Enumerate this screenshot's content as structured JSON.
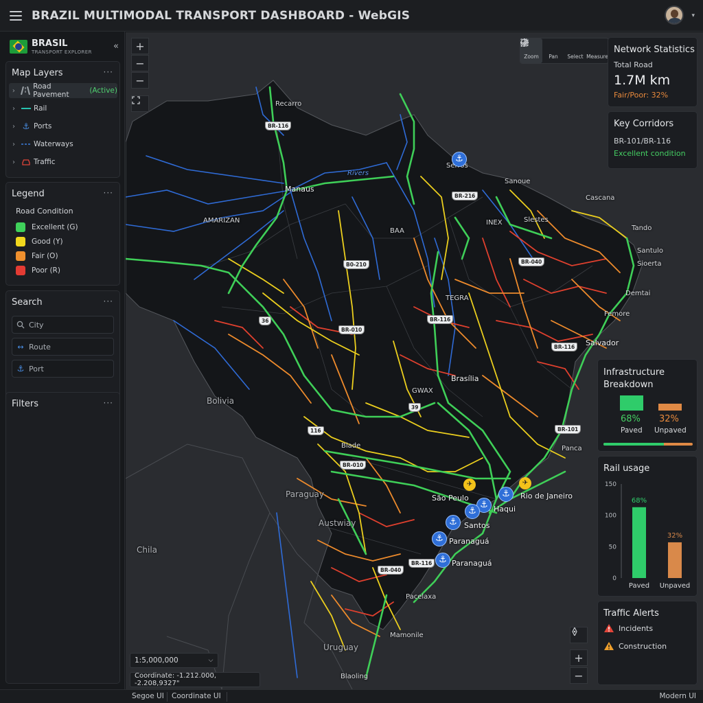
{
  "header": {
    "title": "BRAZIL MULTIMODAL TRANSPORT DASHBOARD - WebGIS"
  },
  "sidebar": {
    "brand": {
      "name": "BRASIL",
      "subtitle": "TRANSPORT EXPLORER"
    },
    "layers": {
      "title": "Map Layers",
      "items": [
        {
          "label": "Road Pavement",
          "tag": "(Active)"
        },
        {
          "label": "Rail"
        },
        {
          "label": "Ports"
        },
        {
          "label": "Waterways"
        },
        {
          "label": "Traffic"
        }
      ]
    },
    "legend": {
      "title": "Legend",
      "heading": "Road Condition",
      "items": [
        {
          "label": "Excellent (G)",
          "color": "#3fd15a"
        },
        {
          "label": "Good (Y)",
          "color": "#f2d81e"
        },
        {
          "label": "Fair (O)",
          "color": "#f0902e"
        },
        {
          "label": "Poor (R)",
          "color": "#e33b33"
        }
      ]
    },
    "search": {
      "title": "Search",
      "fields": [
        {
          "placeholder": "City",
          "icon": "search-icon"
        },
        {
          "placeholder": "Route",
          "icon": "route-icon"
        },
        {
          "placeholder": "Port",
          "icon": "anchor-icon"
        }
      ]
    },
    "filters": {
      "title": "Filters"
    }
  },
  "map": {
    "toolbar": [
      {
        "label": "Zoom",
        "icon": "zoom-icon"
      },
      {
        "label": "Pan",
        "icon": "pan-icon"
      },
      {
        "label": "Select",
        "icon": "select-icon"
      },
      {
        "label": "Measure",
        "icon": "measure-icon"
      }
    ],
    "scale": "1:5,000,000",
    "coordinate": "Coordinate: -1.212.000, -2.208,9327\"",
    "country_labels": [
      "Bolivia",
      "Paraguay",
      "Austwiay",
      "Chila",
      "Uruguay"
    ],
    "region_labels": [
      "AMARIZAN",
      "BAA",
      "TEGRA",
      "INEX",
      "GWAX"
    ],
    "cities": [
      "Recarro",
      "Manaus",
      "Sanoue",
      "Cascana",
      "Tando",
      "Santulo",
      "Sioerta",
      "Demtai",
      "Femore",
      "Salvador",
      "Brasília",
      "Panca",
      "Blade",
      "São Peulo",
      "Rio de Janeiro",
      "Haqui",
      "Santos",
      "Paranaguá",
      "Paranaguá",
      "Pacelaxa",
      "Mamonile",
      "Blaoling",
      "Rivers",
      "Serros",
      "Slestes"
    ],
    "shields": [
      "BR-116",
      "BR-216",
      "B0-210",
      "BR-040",
      "BR-116",
      "BR-010",
      "BR-116",
      "BR-101",
      "BR-040",
      "BR-010",
      "BR-116",
      "36",
      "39",
      "116"
    ]
  },
  "panels": {
    "network": {
      "title": "Network Statistics",
      "label": "Total Road",
      "value": "1.7M km",
      "note": "Fair/Poor: 32%"
    },
    "corridors": {
      "title": "Key Corridors",
      "name": "BR-101/BR-116",
      "status": "Excellent condition"
    },
    "infrastructure": {
      "title_line1": "Infrastructure",
      "title_line2": "Breakdown",
      "paved_pct": "68%",
      "paved_label": "Paved",
      "unpaved_pct": "32%",
      "unpaved_label": "Unpaved",
      "paved_share": 0.68
    },
    "rail_usage": {
      "title": "Rail usage"
    },
    "alerts": {
      "title": "Traffic Alerts",
      "items": [
        {
          "label": "Incidents",
          "color": "#e2453a"
        },
        {
          "label": "Construction",
          "color": "#f0a02c"
        }
      ]
    }
  },
  "chart_data": {
    "type": "bar",
    "title": "Rail usage",
    "categories": [
      "Paved",
      "Unpaved"
    ],
    "values": [
      113,
      57
    ],
    "data_labels": [
      "68%",
      "32%"
    ],
    "ylim": [
      0,
      150
    ],
    "yticks": [
      0,
      50,
      100,
      150
    ],
    "colors": [
      "#2fcc6a",
      "#d9894a"
    ]
  },
  "statusbar": {
    "font": "Segoe UI",
    "coord": "Coordinate UI",
    "theme": "Modern UI"
  }
}
